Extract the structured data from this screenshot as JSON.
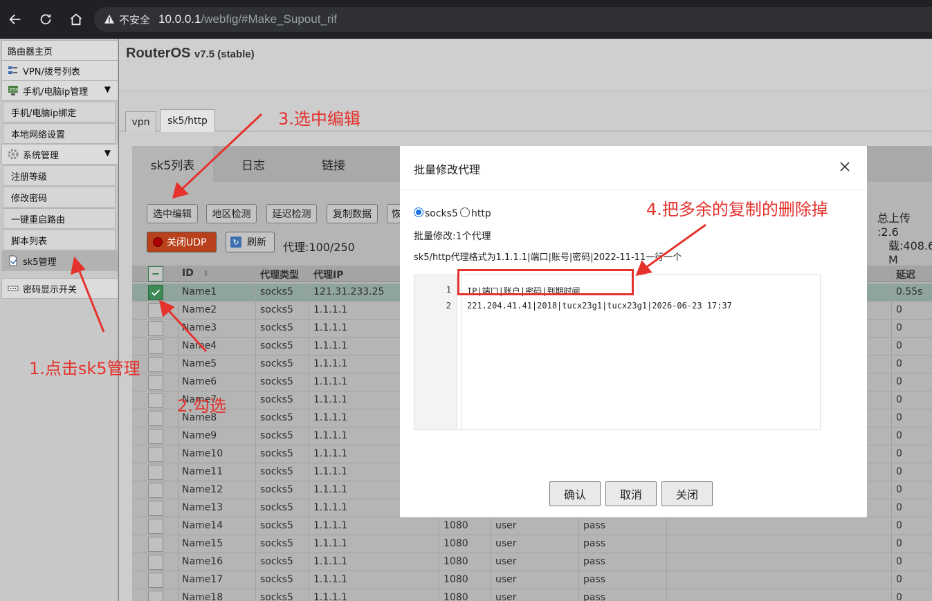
{
  "browser": {
    "insecure_label": "不安全",
    "url_host": "10.0.0.1",
    "url_path": "/webfig/#Make_Supout_rif"
  },
  "sidebar": {
    "items": [
      {
        "label": "路由器主页"
      },
      {
        "label": "VPN/拨号列表"
      },
      {
        "label": "手机/电脑ip管理"
      },
      {
        "label": "手机/电脑ip绑定"
      },
      {
        "label": "本地网络设置"
      },
      {
        "label": "系统管理"
      },
      {
        "label": "注册等级"
      },
      {
        "label": "修改密码"
      },
      {
        "label": "一键重启路由"
      },
      {
        "label": "脚本列表"
      },
      {
        "label": "sk5管理"
      },
      {
        "label": "密码显示开关"
      }
    ],
    "expand_arrow": "▼"
  },
  "header": {
    "brand": "RouterOS",
    "version": "v7.5 (stable)"
  },
  "tabs": [
    {
      "label": "vpn"
    },
    {
      "label": "sk5/http"
    }
  ],
  "panel": {
    "tabs": [
      {
        "label": "sk5列表"
      },
      {
        "label": "日志"
      },
      {
        "label": "链接"
      }
    ],
    "toolbar": {
      "edit_selected": "选中编辑",
      "region_check": "地区检测",
      "latency_check": "延迟检测",
      "copy_data": "复制数据",
      "restore_partial": "恢",
      "close_udp": "关闭UDP",
      "refresh": "刷新",
      "proxy_count": "代理:100/250",
      "total_upload": "总上传 :2.6",
      "total_download": "载:408.6 M"
    }
  },
  "table": {
    "headers": {
      "id": "ID",
      "type": "代理类型",
      "ip": "代理IP",
      "latency": "延迟"
    },
    "rows": [
      {
        "name": "Name1",
        "type": "socks5",
        "ip": "121.31.233.25",
        "port": "",
        "user": "",
        "pass": "",
        "latency": "0.55s",
        "checked": true
      },
      {
        "name": "Name2",
        "type": "socks5",
        "ip": "1.1.1.1",
        "port": "",
        "user": "",
        "pass": "",
        "latency": "0",
        "checked": false
      },
      {
        "name": "Name3",
        "type": "socks5",
        "ip": "1.1.1.1",
        "port": "",
        "user": "",
        "pass": "",
        "latency": "0",
        "checked": false
      },
      {
        "name": "Name4",
        "type": "socks5",
        "ip": "1.1.1.1",
        "port": "",
        "user": "",
        "pass": "",
        "latency": "0",
        "checked": false
      },
      {
        "name": "Name5",
        "type": "socks5",
        "ip": "1.1.1.1",
        "port": "",
        "user": "",
        "pass": "",
        "latency": "0",
        "checked": false
      },
      {
        "name": "Name6",
        "type": "socks5",
        "ip": "1.1.1.1",
        "port": "",
        "user": "",
        "pass": "",
        "latency": "0",
        "checked": false
      },
      {
        "name": "Name7",
        "type": "socks5",
        "ip": "1.1.1.1",
        "port": "",
        "user": "",
        "pass": "",
        "latency": "0",
        "checked": false
      },
      {
        "name": "Name8",
        "type": "socks5",
        "ip": "1.1.1.1",
        "port": "",
        "user": "",
        "pass": "",
        "latency": "0",
        "checked": false
      },
      {
        "name": "Name9",
        "type": "socks5",
        "ip": "1.1.1.1",
        "port": "",
        "user": "",
        "pass": "",
        "latency": "0",
        "checked": false
      },
      {
        "name": "Name10",
        "type": "socks5",
        "ip": "1.1.1.1",
        "port": "",
        "user": "",
        "pass": "",
        "latency": "0",
        "checked": false
      },
      {
        "name": "Name11",
        "type": "socks5",
        "ip": "1.1.1.1",
        "port": "",
        "user": "",
        "pass": "",
        "latency": "0",
        "checked": false
      },
      {
        "name": "Name12",
        "type": "socks5",
        "ip": "1.1.1.1",
        "port": "",
        "user": "",
        "pass": "",
        "latency": "0",
        "checked": false
      },
      {
        "name": "Name13",
        "type": "socks5",
        "ip": "1.1.1.1",
        "port": "",
        "user": "",
        "pass": "",
        "latency": "0",
        "checked": false
      },
      {
        "name": "Name14",
        "type": "socks5",
        "ip": "1.1.1.1",
        "port": "1080",
        "user": "user",
        "pass": "pass",
        "latency": "0",
        "checked": false
      },
      {
        "name": "Name15",
        "type": "socks5",
        "ip": "1.1.1.1",
        "port": "1080",
        "user": "user",
        "pass": "pass",
        "latency": "0",
        "checked": false
      },
      {
        "name": "Name16",
        "type": "socks5",
        "ip": "1.1.1.1",
        "port": "1080",
        "user": "user",
        "pass": "pass",
        "latency": "0",
        "checked": false
      },
      {
        "name": "Name17",
        "type": "socks5",
        "ip": "1.1.1.1",
        "port": "1080",
        "user": "user",
        "pass": "pass",
        "latency": "0",
        "checked": false
      },
      {
        "name": "Name18",
        "type": "socks5",
        "ip": "1.1.1.1",
        "port": "1080",
        "user": "user",
        "pass": "pass",
        "latency": "0",
        "checked": false
      }
    ]
  },
  "modal": {
    "title": "批量修改代理",
    "radio_socks5": "socks5",
    "radio_http": "http",
    "selected_protocol": "socks5",
    "count_text": "批量修改:1个代理",
    "format_text": "sk5/http代理格式为1.1.1.1|端口|账号|密码|2022-11-11一行一个",
    "editor_lines": [
      {
        "num": "1",
        "text": "IP|端口|账户|密码|到期时间"
      },
      {
        "num": "2",
        "text": "221.204.41.41|2018|tucx23g1|tucx23g1|2026-06-23 17:37"
      }
    ],
    "confirm": "确认",
    "cancel": "取消",
    "close": "关闭"
  },
  "annotations": {
    "step1": "1.点击sk5管理",
    "step2": "2.勾选",
    "step3": "3.选中编辑",
    "step4": "4.把多余的复制的删除掉"
  },
  "colors": {
    "annotation_red": "#e5322d",
    "selected_row": "#8fa59b",
    "checkbox_green": "#3d8a56"
  }
}
